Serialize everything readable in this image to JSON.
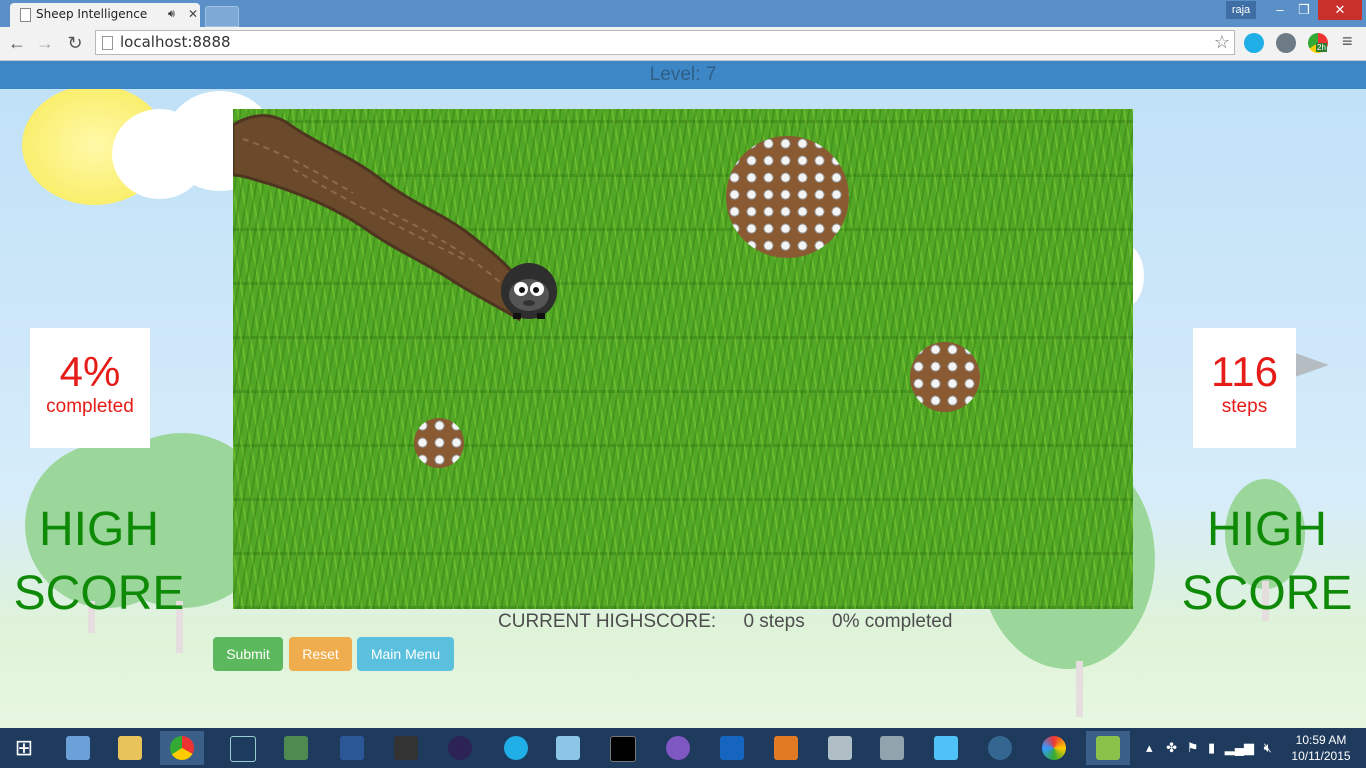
{
  "browser": {
    "tab_title": "Sheep Intelligence",
    "user": "raja",
    "url": "localhost:8888",
    "icons": [
      "back-icon",
      "forward-icon",
      "reload-icon",
      "star-icon",
      "skype-icon",
      "eye-icon",
      "chrome-ext-icon",
      "menu-icon"
    ],
    "ext_badge": "2h"
  },
  "game": {
    "level_label": "Level: 7",
    "progress": {
      "value": "4%",
      "label": "completed"
    },
    "steps": {
      "value": "116",
      "label": "steps"
    },
    "high_score_left": "HIGH SCORE",
    "high_score_right": "HIGH SCORE",
    "current_highscore": {
      "label": "CURRENT HIGHSCORE:",
      "steps": "0 steps",
      "completed": "0% completed"
    },
    "buttons": {
      "submit": "Submit",
      "reset": "Reset",
      "main_menu": "Main Menu"
    },
    "colors": {
      "submit": "#5cb85c",
      "reset": "#f0ad4e",
      "main_menu": "#5bc0de",
      "score_text": "#e51c17",
      "high_score": "#0f8a07"
    }
  },
  "taskbar": {
    "apps": [
      "start-icon",
      "computer-icon",
      "explorer-icon",
      "chrome-icon",
      "terminal-icon",
      "network-icon",
      "word-icon",
      "wps-icon",
      "eclipse-icon",
      "skype-icon",
      "notes-icon",
      "cmd-icon",
      "github-icon",
      "powershell-icon",
      "meteor-icon",
      "monitor-icon",
      "calculator-icon",
      "remote-desktop-icon",
      "postgres-icon",
      "paint-icon",
      "notepadpp-icon"
    ],
    "time": "10:59 AM",
    "date": "10/11/2015"
  }
}
